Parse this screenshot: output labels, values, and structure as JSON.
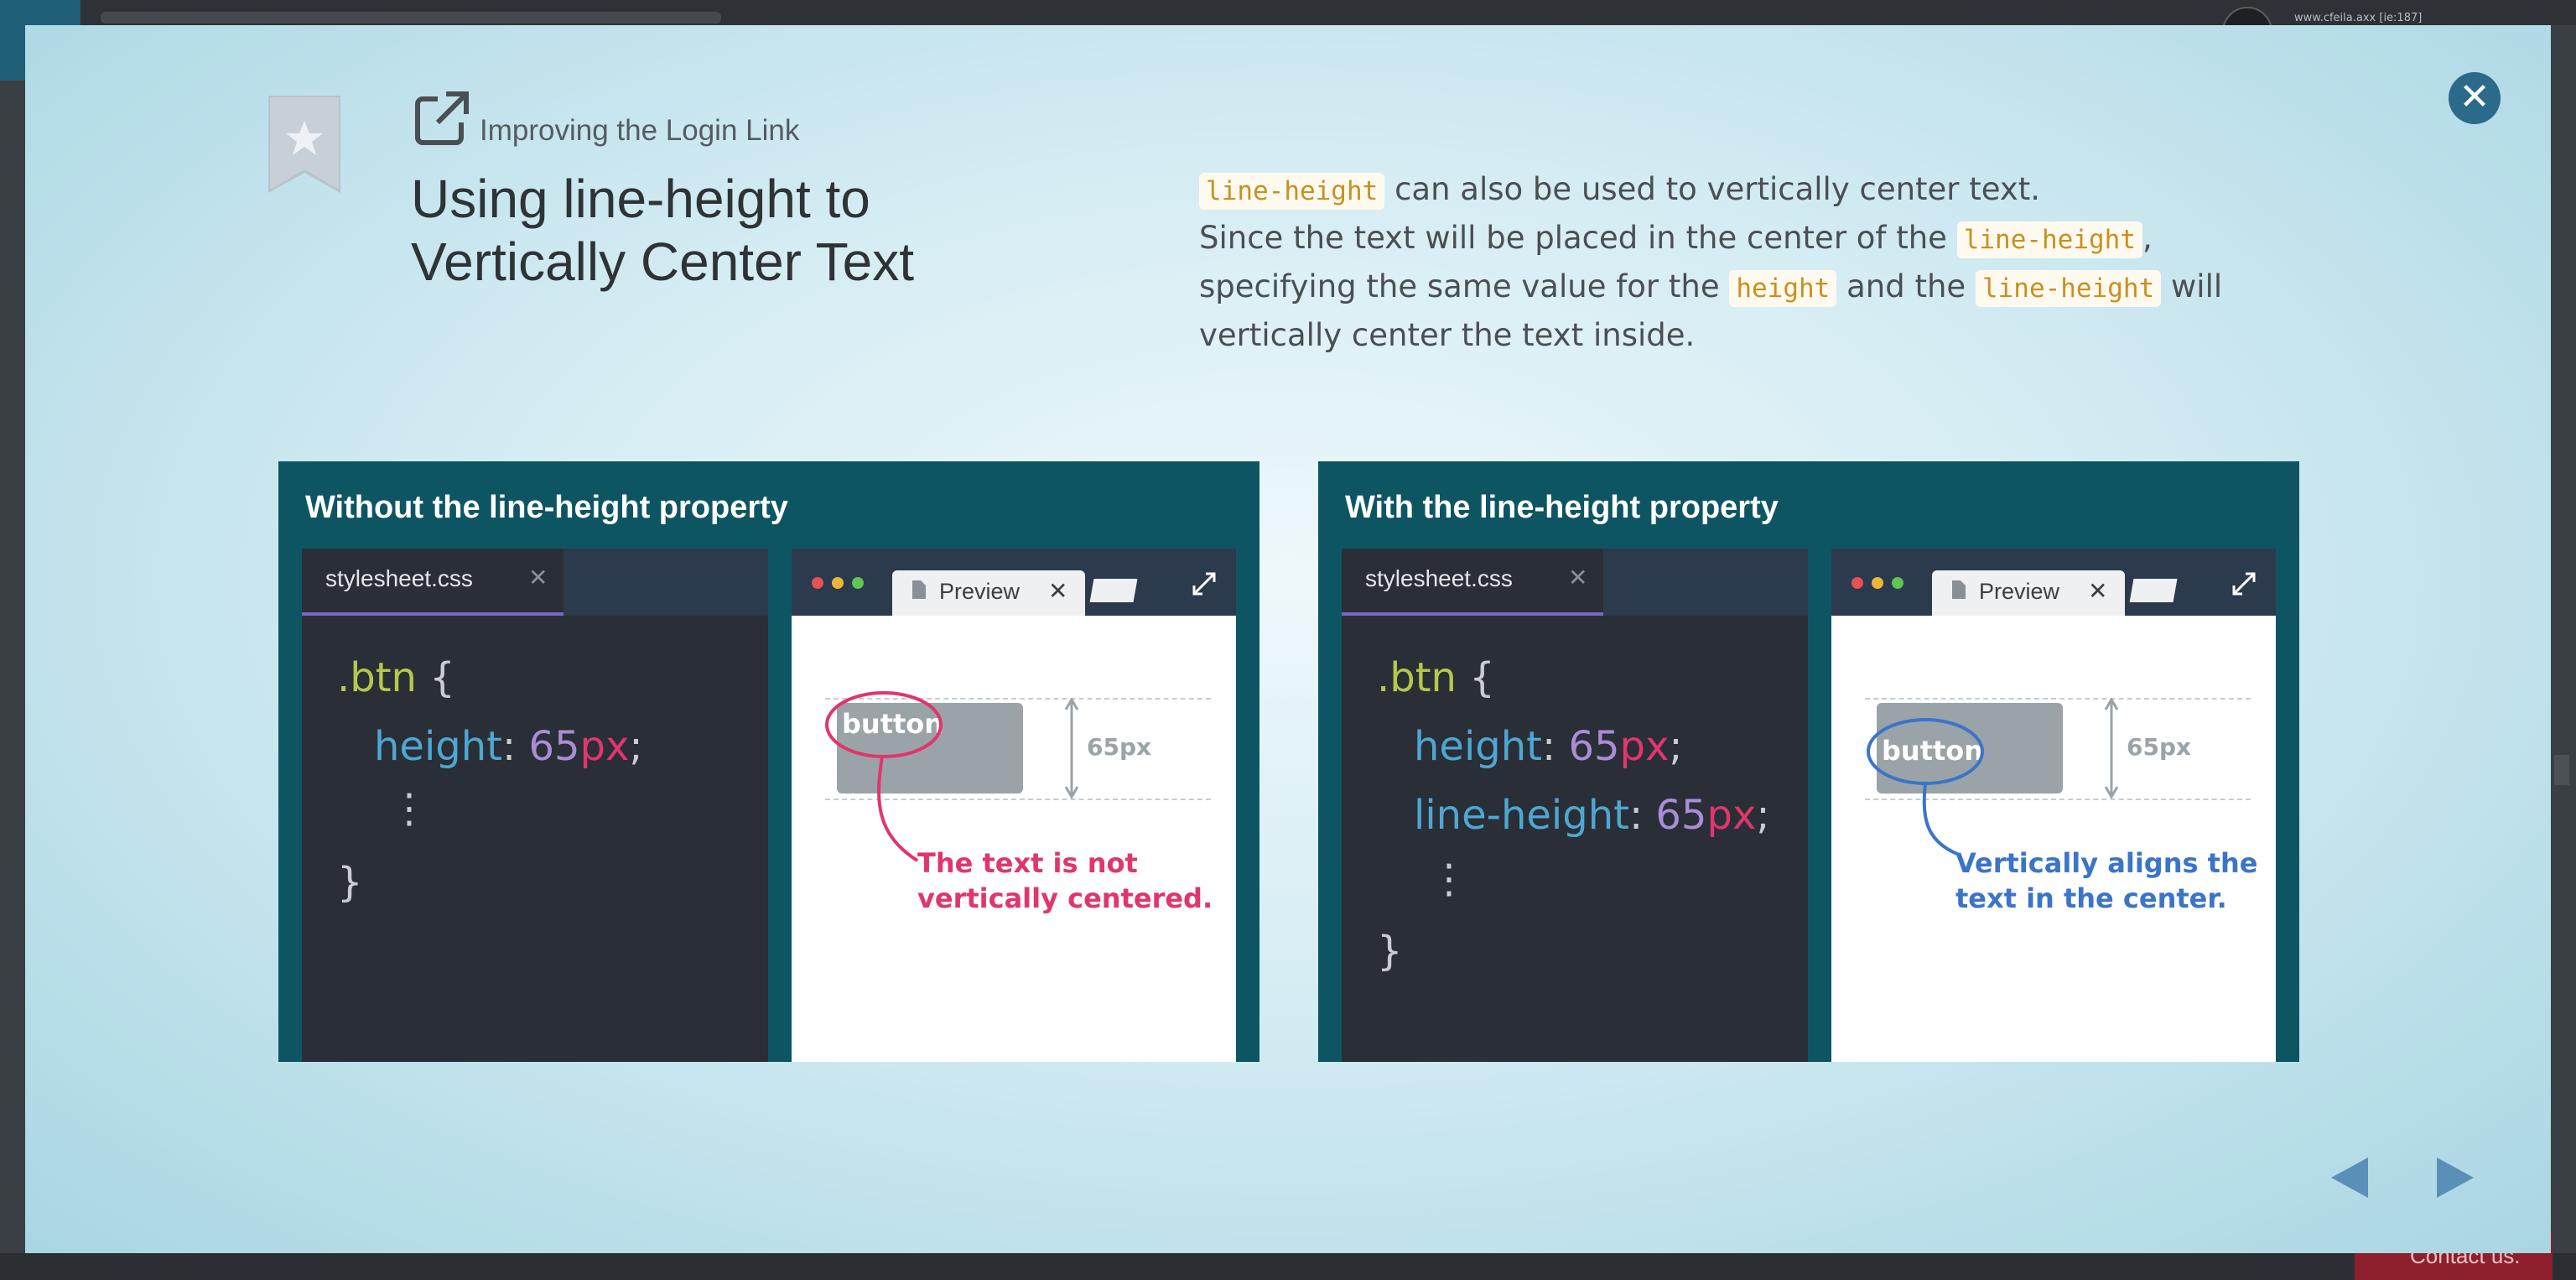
{
  "background_page": {
    "url_text": "www.cfeila.axx [ie:187]",
    "contact_label": "Contact us."
  },
  "modal": {
    "subtitle": "Improving the Login Link",
    "title": "Using line-height to Vertically Center Text",
    "description": {
      "line1_code": "line-height",
      "line1_text": " can also be used to vertically center text.",
      "line2_text_a": "Since the text will be placed in the center of the ",
      "line2_code": "line-height",
      "line2_text_b": ", specifying the same value for the ",
      "line3_code_a": "height",
      "line3_text": " and the ",
      "line3_code_b": "line-height",
      "line3_text_b": " will vertically center the text inside."
    },
    "colors": {
      "panel_bg": "#0e5563",
      "accent_pink": "#e0366b",
      "accent_blue": "#3b74c9",
      "close_button": "#2c6a8a"
    }
  },
  "panels": [
    {
      "title": "Without the line-height property",
      "editor_tab": "stylesheet.css",
      "code": {
        "selector": ".btn",
        "open": " {",
        "lines": [
          {
            "prop": "height",
            "num": "65",
            "unit": "px"
          }
        ],
        "ellipsis": "⋮",
        "close": "}"
      },
      "preview_tab": "Preview",
      "button_text": "button",
      "measure_label": "65px",
      "callout": [
        "The text is not",
        "vertically centered."
      ]
    },
    {
      "title": "With the line-height property",
      "editor_tab": "stylesheet.css",
      "code": {
        "selector": ".btn",
        "open": " {",
        "lines": [
          {
            "prop": "height",
            "num": "65",
            "unit": "px"
          },
          {
            "prop": "line-height",
            "num": "65",
            "unit": "px"
          }
        ],
        "ellipsis": "⋮",
        "close": "}"
      },
      "preview_tab": "Preview",
      "button_text": "button",
      "measure_label": "65px",
      "callout": [
        "Vertically aligns the",
        "text in the center."
      ]
    }
  ],
  "icons": {
    "close": "close-icon",
    "bookmark": "bookmark-star-icon",
    "external_link": "external-link-icon",
    "prev": "previous-arrow-icon",
    "next": "next-arrow-icon"
  }
}
